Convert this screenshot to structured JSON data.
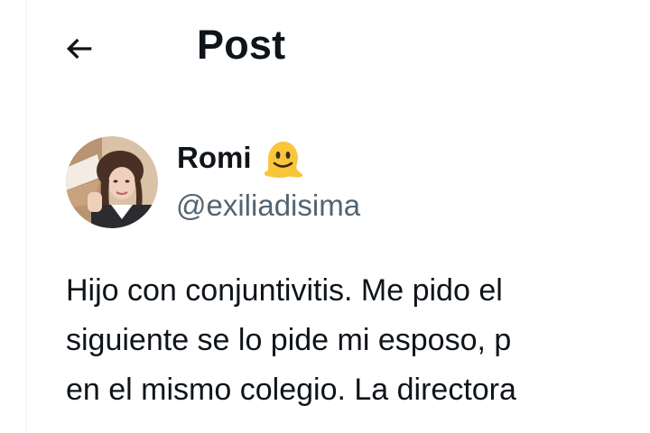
{
  "header": {
    "back_icon": "arrow-left-icon",
    "title": "Post"
  },
  "author": {
    "name": "Romi",
    "name_emoji": "melting-face-emoji",
    "handle": "@exiliadisima"
  },
  "post": {
    "lines": [
      "Hijo con conjuntivitis. Me pido el",
      "siguiente se lo pide mi esposo, p",
      "en el mismo colegio. La directora"
    ]
  },
  "colors": {
    "text_primary": "#0f1419",
    "text_secondary": "#536471",
    "divider": "#eff3f4",
    "emoji_yellow": "#f9c53b"
  }
}
